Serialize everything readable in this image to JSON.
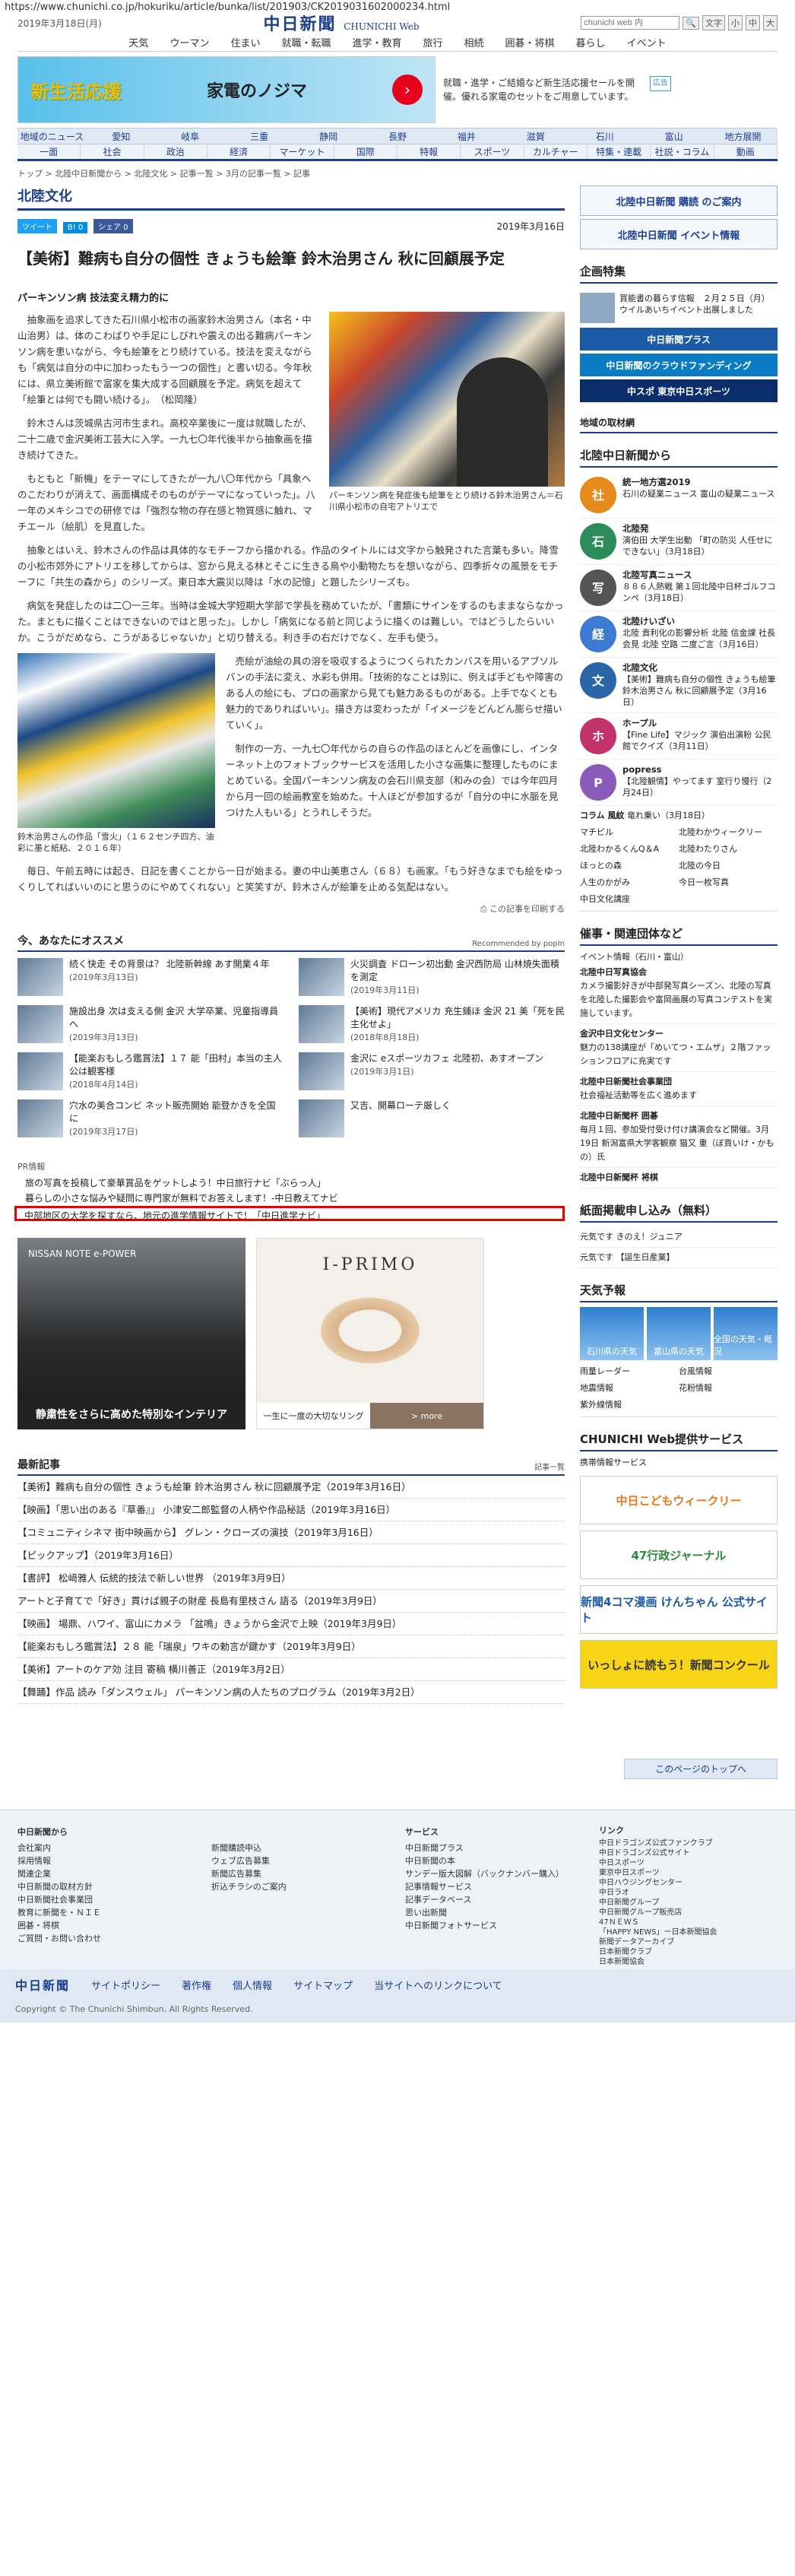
{
  "url": "https://www.chunichi.co.jp/hokuriku/article/bunka/list/201903/CK2019031602000234.html",
  "header": {
    "date": "2019年3月18日(月)",
    "logo": "中日新聞",
    "logo_sub": "CHUNICHI Web",
    "search_placeholder": "chunichi web 内",
    "font_label": "文字",
    "font_sizes": [
      "小",
      "中",
      "大"
    ]
  },
  "gnav": [
    "天気",
    "ウーマン",
    "住まい",
    "就職・転職",
    "進学・教育",
    "旅行",
    "相続",
    "囲碁・将棋",
    "暮らし",
    "イベント"
  ],
  "ad_top": {
    "left_text": "新生活応援",
    "brand": "家電のノジマ",
    "right_text": "就職・進学・ご結婚など新生活応援セールを開催。優れる家電のセットをご用意しています。",
    "ad_label": "広告"
  },
  "region_nav": [
    "地域のニュース",
    "愛知",
    "岐阜",
    "三重",
    "静岡",
    "長野",
    "福井",
    "滋賀",
    "石川",
    "富山",
    "地方展開"
  ],
  "section_nav": [
    "一面",
    "社会",
    "政治",
    "経済",
    "マーケット",
    "国際",
    "特報",
    "スポーツ",
    "カルチャー",
    "特集・連載",
    "社説・コラム",
    "動画"
  ],
  "breadcrumb": "トップ > 北陸中日新聞から > 北陸文化 > 記事一覧 > 3月の記事一覧 > 記事",
  "section_title": "北陸文化",
  "share": {
    "tweet": "ツイート",
    "hatena": "B! 0",
    "fb": "シェア 0"
  },
  "article": {
    "date": "2019年3月16日",
    "headline": "【美術】難病も自分の個性 きょうも絵筆 鈴木治男さん 秋に回顧展予定",
    "subhead": "パーキンソン病 技法変え精力的に",
    "paragraphs": [
      "抽象画を追求してきた石川県小松市の画家鈴木治男さん（本名・中山治男）は、体のこわばりや手足にしびれや震えの出る難病パーキンソン病を患いながら、今も絵筆をとり続けている。技法を変えながらも「病気は自分の中に加わったもう一つの個性」と書い切る。今年秋には、県立美術館で富家を集大成する回顧展を予定。病気を超えて「絵筆とは何でも闘い続ける」。　（松岡隆）",
      "鈴木さんは茨城県古河市生まれ。高校卒業後に一度は就職したが、二十二歳で金沢美術工芸大に入学。一九七〇年代後半から抽象画を描き続けてきた。",
      "もともと「新機」をテーマにしてきたが一九八〇年代から「具象へのこだわりが消えて、画面構成そのものがテーマになっていった」。八一年のメキシコでの研修では「強烈な物の存在感と物質感に触れ、マチエール（絵肌）を見直した。",
      "抽象とはいえ、鈴木さんの作品は具体的なモチーフから描かれる。作品のタイトルには文字から触発された言葉も多い。降雪の小松市郊外にアトリエを移してからは、窓から見える林とそこに生きる鳥や小動物たちを想いながら、四季折々の風景をモチーフに「共生の森から」のシリーズ。東日本大震災以降は「水の記憶」と題したシリーズも。",
      "病気を発症したのは二〇一三年。当時は金城大学短期大学部で学長を務めていたが、「書類にサインをするのもままならなかった。まともに描くことはできないのではと思った」。しかし「病気になる前と同じように描くのは難しい。ではどうしたらいいか。こうがだめなら、こうがあるじゃないか」と切り替える。利き手の右だけでなく、左手も使う。",
      "売絵が油絵の具の溶を吸収するようにつくられたカンバスを用いるアブソルバンの手法に変え、水彩も併用。「技術的なことは別に、例えば手どもや障害のある人の絵にも、プロの画家から見ても魅力あるものがある。上手でなくとも魅力的でありればいい」。描き方は変わったが「イメージをどんどん膨らせ描いていく」。",
      "制作の一方、一九七〇年代からの自らの作品のほとんどを画像にし、インターネット上のフォトブックサービスを活用した小さな画集に整理したものにまとめている。全国パーキンソン病友の会石川県支部（和みの会）では今年四月から月一回の絵画教室を始めた。十人ほどが参加するが「自分の中に水脈を見つけた人もいる」とうれしそうだ。",
      "毎日、午前五時には起き、日記を書くことから一日が始まる。妻の中山美恵さん（６８）も画家。「もう好きなまでも絵をゆっくりしてればいいのにと思うのにやめてくれない」と笑笑すが、鈴木さんが絵筆を止める気配はない。"
    ],
    "fig1_caption": "パーキンソン病を発症後も絵筆をとり続ける鈴木治男さん＝石川県小松市の自宅アトリエで",
    "fig2_caption": "鈴木治男さんの作品「雪火」（１６２センチ四方、油彩に墨と紙粘、２０１６年）",
    "print_link": "この記事を印刷する"
  },
  "recommend": {
    "title": "今、あなたにオススメ",
    "by": "Recommended by popIn",
    "items": [
      {
        "text": "続く快走 その背景は？ 北陸新幹線 あす開業４年",
        "date": "(2019年3月13日)"
      },
      {
        "text": "火災調査 ドローン初出動 金沢西防局 山林焼失面積を測定",
        "date": "(2019年3月11日)"
      },
      {
        "text": "施設出身 次は支える側 金沢 大学卒業、児童指導員へ",
        "date": "(2019年3月13日)"
      },
      {
        "text": "【美術】現代アメリカ 充生鋪ほ 金沢 21 美「死を民主化せよ」",
        "date": "(2018年8月18日)"
      },
      {
        "text": "【能楽おもしろ鑑賞法】１７ 能「田村」本当の主人公は観客様",
        "date": "(2018年4月14日)"
      },
      {
        "text": "金沢に eスポーツカフェ 北陸初、あすオープン",
        "date": "(2019年3月1日)"
      },
      {
        "text": "穴水の美合コンビ ネット販売開始 能登かきを全国に",
        "date": "(2019年3月17日)"
      },
      {
        "text": "又吉、開幕ローテ厳しく",
        "date": ""
      }
    ]
  },
  "pr": {
    "label": "PR情報",
    "rows": [
      "旅の写真を投稿して豪華賞品をゲットしよう！中日旅行ナビ「ぶらっ人」",
      "暮らしの小さな悩みや疑問に専門家が無料でお答えします！-中日教えてナビ",
      "中部地区の大学を探すなら、地元の進学情報サイトで！「中日進学ナビ」"
    ]
  },
  "ad_bottom": {
    "nissan_foot": "静粛性をさらに高めた特別なインテリア",
    "nissan_brand": "NISSAN NOTE e-POWER",
    "primo_title": "I-PRIMO",
    "primo_left": "一生に一度の大切なリング",
    "primo_more": "> more"
  },
  "latest": {
    "title": "最新記事",
    "list_link": "記事一覧",
    "rows": [
      "【美術】難病も自分の個性 きょうも絵筆 鈴木治男さん 秋に回顧展予定（2019年3月16日）",
      "【映画】「思い出のある『草番』」 小津安二郎監督の人柄や作品秘話（2019年3月16日）",
      "【コミュニティシネマ 街中映画から】 グレン・クローズの演技（2019年3月16日）",
      "【ピックアップ】（2019年3月16日）",
      "【書評】 松﨑雅人 伝統的技法で新しい世界 （2019年3月9日）",
      "アートと子育てで「好き」貫けば親子の財産 長島有里枝さん 語る（2019年3月9日）",
      "【映画】 場鼎、ハワイ、富山にカメラ 「盆鳴」きょうから金沢で上映（2019年3月9日）",
      "【能楽おもしろ鑑賞法】２８ 能「瑞泉」ワキの勅言が鍵かす（2019年3月9日）",
      "【美術】アートのケア効 注目 寄稿 横川善正（2019年3月2日）",
      "【舞踊】作品 読み「ダンスウェル」 パーキンソン病の人たちのプログラム（2019年3月2日）"
    ]
  },
  "totop": "このページのトップへ",
  "side": {
    "subscribe": "北陸中日新聞 購読 のご案内",
    "event": "北陸中日新聞 イベント情報",
    "kikaku_title": "企画特集",
    "kikaku_text": "買能書の暮らす信報　２月２５日（月）ウイルあいちイベント出展しました",
    "banners": [
      "中日新聞プラス",
      "中日新聞のクラウドファンディング",
      "中スポ 東京中日スポーツ"
    ],
    "local_info": "地域の取材網",
    "from_title": "北陸中日新聞から",
    "from_items": [
      {
        "icon": "社",
        "color": "#e68a1c",
        "title": "統一地方選2019",
        "text": "石川の疑業ニュース 富山の疑業ニュース"
      },
      {
        "icon": "石",
        "color": "#2c8c5a",
        "title": "北陸発",
        "text": "演伯田 大学生出動 「町の防災 人任せにできない」（3月18日）"
      },
      {
        "icon": "写",
        "color": "#555",
        "title": "北陸写真ニュース",
        "text": "８８６人熱戦 第１回北陸中日杯ゴルフコンペ（3月18日）"
      },
      {
        "icon": "経",
        "color": "#3c7bd1",
        "title": "北陸けいざい",
        "text": "北陸 貴利化の影響分析 北陸 信金課 社長会見 北陸 空路 二度ご言（3月16日）"
      },
      {
        "icon": "文",
        "color": "#2a65a8",
        "title": "北陸文化",
        "text": "【美術】難病も自分の個性 きょうも絵筆 鈴木治男さん 秋に回顧展予定（3月16日）"
      },
      {
        "icon": "ホ",
        "color": "#c2336b",
        "title": "ホープル",
        "text": "【Fine Life】マジック 演伯出演粉 公民館でクイズ（3月11日）"
      },
      {
        "icon": "P",
        "color": "#8a5bb8",
        "title": "popress",
        "text": "【北陸観情】やってます 室行り慢行（2月24日）"
      }
    ],
    "links": [
      "コラム 風紋",
      "マチビル",
      "北陸わかるくんQ＆A",
      "ほっとの森",
      "人生のかがみ",
      "中日文化講座",
      "北陸わかウィークリー",
      "北陸わたりさん",
      "北陸の今日",
      "今日一枚写真"
    ],
    "column_text": "竜れ乗い（3月18日）",
    "event_title": "催事・関連団体など",
    "event_sub": "イベント情報（石川・富山）",
    "events": [
      {
        "title": "北陸中日写真協会",
        "text": "カメラ撮影好きが中部発写真シーズン、北陸の写真を北陸した撮影会や富岡画展の写真コンテストを実施しています。"
      },
      {
        "title": "金沢中日文化センター",
        "text": "魅力の138講座が「めいてつ・エムザ」２階ファッションフロアに充実です"
      },
      {
        "title": "北陸中日新聞社会事業団",
        "text": "社会福祉活動等を広く進めます"
      },
      {
        "title": "北陸中日新聞杯 囲碁",
        "text": "毎月１回、参加受付受け付け講演会など開催。3月19日 新潟富県大学客観察 猫又 重（ぼ貢いけ・かもの）氏"
      },
      {
        "title": "北陸中日新聞杯 将棋",
        "text": ""
      }
    ],
    "mag_title": "紙面掲載申し込み（無料）",
    "mag_items": [
      "元気です きのえ！ジュニア",
      "元気です 【誕生日産業】"
    ],
    "weather_title": "天気予報",
    "weather": [
      "石川県の天気",
      "富山県の天気",
      "全国の天気・概況"
    ],
    "weather_links": [
      "雨量レーダー",
      "台風情報",
      "地震情報",
      "花粉情報",
      "紫外線情報"
    ],
    "svc_title": "CHUNICHI Web提供サービス",
    "svc_link": "携帯情報サービス",
    "big_banners": [
      "中日こどもウィークリー",
      "47行政ジャーナル",
      "新聞4コマ漫画 けんちゃん 公式サイト",
      "いっしょに読もう！新聞コンクール"
    ]
  },
  "footer": {
    "cols": [
      {
        "title": "中日新聞から",
        "items": [
          "会社案内",
          "採用情報",
          "関連企業",
          "中日新聞の取材方針",
          "中日新聞社会事業団",
          "教育に新聞を・ＮＩＥ",
          "囲碁・将棋",
          "ご質問・お問い合わせ"
        ]
      },
      {
        "title": "",
        "items": [
          "新聞購読申込",
          "ウェブ広告募集",
          "新聞広告募集",
          "折込チラシのご案内"
        ]
      },
      {
        "title": "サービス",
        "items": [
          "中日新聞プラス",
          "中日新聞の本",
          "サンデー版大図解（バックナンバー購入）",
          "記事情報サービス",
          "記事データベース",
          "思い出新聞",
          "中日新聞フォトサービス"
        ]
      },
      {
        "title": "リンク",
        "items": [
          "中日ドラゴンズ公式ファンクラブ",
          "中日ドラゴンズ公式サイト",
          "中日スポーツ",
          "東京中日スポーツ",
          "中日ハウジングセンター",
          "中日ラオ",
          "中日新聞グループ",
          "中日新聞グループ販売店",
          "47ＮＥＷＳ",
          "「HAPPY NEWS」ー日本新聞協会",
          "新聞データアーカイブ",
          "日本新聞クラブ",
          "日本新聞協会"
        ]
      }
    ],
    "bar": [
      "中日新聞",
      "サイトポリシー",
      "著作権",
      "個人情報",
      "サイトマップ",
      "当サイトへのリンクについて"
    ],
    "copyright": "Copyright © The Chunichi Shimbun, All Rights Reserved."
  }
}
